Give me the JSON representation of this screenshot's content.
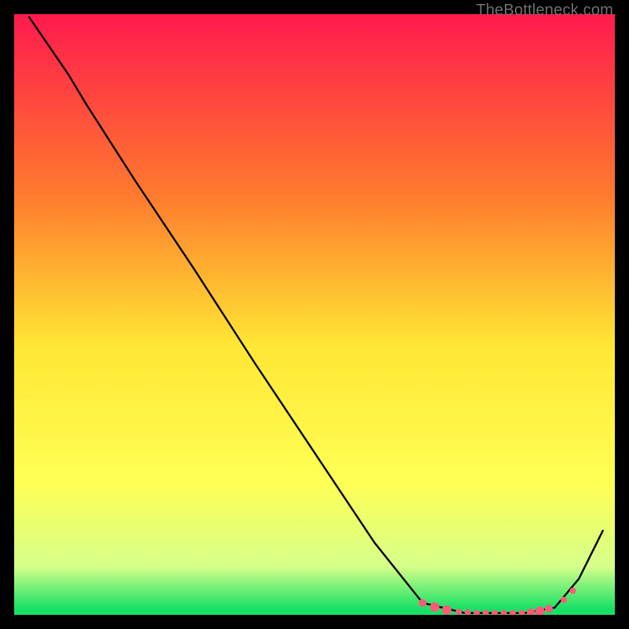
{
  "watermark": "TheBottleneck.com",
  "chart_data": {
    "type": "line",
    "title": "",
    "xlabel": "",
    "ylabel": "",
    "xlim": [
      0,
      100
    ],
    "ylim": [
      0,
      100
    ],
    "background_gradient": {
      "top": "#ff1a4d",
      "upper_mid": "#ffa030",
      "mid": "#ffe634",
      "lower_mid": "#f3ff80",
      "bottom": "#18e066"
    },
    "frame_color": "#000000",
    "series": [
      {
        "name": "bottleneck-curve",
        "x": [
          2.5,
          9.0,
          12.0,
          20.0,
          30.0,
          40.0,
          50.0,
          60.0,
          68.0,
          75.0,
          80.0,
          85.0,
          90.0,
          94.0,
          98.0
        ],
        "y": [
          99.5,
          90.0,
          85.0,
          72.5,
          57.5,
          42.0,
          27.0,
          12.0,
          2.0,
          0.3,
          0.3,
          0.3,
          1.2,
          6.0,
          14.0
        ],
        "note": "y is a percentage-like metric; curve descends steeply, bottoms near x≈75–88, then rises."
      }
    ],
    "markers": {
      "name": "trough-markers",
      "color": "#ff5a78",
      "points": [
        {
          "x": 68.0,
          "y": 2.0,
          "r": 5
        },
        {
          "x": 70.0,
          "y": 1.3,
          "r": 6
        },
        {
          "x": 72.0,
          "y": 0.8,
          "r": 6
        },
        {
          "x": 74.0,
          "y": 0.5,
          "r": 4
        },
        {
          "x": 75.5,
          "y": 0.4,
          "r": 4
        },
        {
          "x": 77.0,
          "y": 0.3,
          "r": 4
        },
        {
          "x": 78.5,
          "y": 0.3,
          "r": 4
        },
        {
          "x": 80.0,
          "y": 0.3,
          "r": 4
        },
        {
          "x": 81.5,
          "y": 0.3,
          "r": 4
        },
        {
          "x": 83.0,
          "y": 0.3,
          "r": 4
        },
        {
          "x": 84.5,
          "y": 0.3,
          "r": 4
        },
        {
          "x": 86.0,
          "y": 0.4,
          "r": 5
        },
        {
          "x": 87.5,
          "y": 0.6,
          "r": 6
        },
        {
          "x": 89.0,
          "y": 1.0,
          "r": 5
        },
        {
          "x": 91.5,
          "y": 2.5,
          "r": 4
        },
        {
          "x": 93.0,
          "y": 4.0,
          "r": 4
        }
      ]
    }
  }
}
